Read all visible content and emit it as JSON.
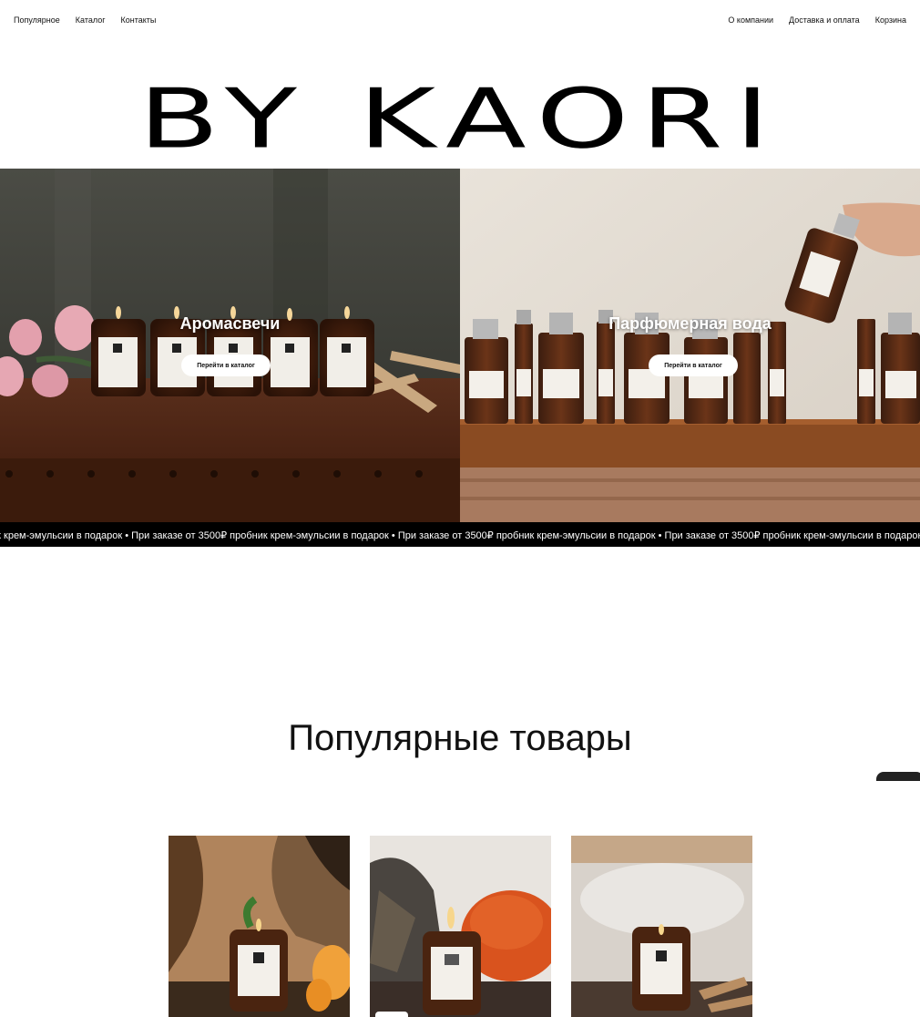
{
  "nav": {
    "left": [
      "Популярное",
      "Каталог",
      "Контакты"
    ],
    "right": [
      "О компании",
      "Доставка и оплата",
      "Корзина"
    ]
  },
  "logo": "BY KAORI",
  "hero": {
    "left": {
      "title": "Аромасвечи",
      "button": "Перейти в каталог"
    },
    "right": {
      "title": "Парфюмерная вода",
      "button": "Перейти в каталог"
    }
  },
  "ticker": "ик крем-эмульсии в подарок  •  При заказе от 3500₽ пробник крем-эмульсии в подарок  •  При заказе от 3500₽ пробник крем-эмульсии в подарок  •  При заказе от 3500₽ пробник крем-эмульсии в подарок  •  При заказе от 3500₽ пробн",
  "section": {
    "title": "Популярные товары"
  },
  "colors": {
    "ticker_bg": "#000000",
    "accent": "#111111"
  }
}
